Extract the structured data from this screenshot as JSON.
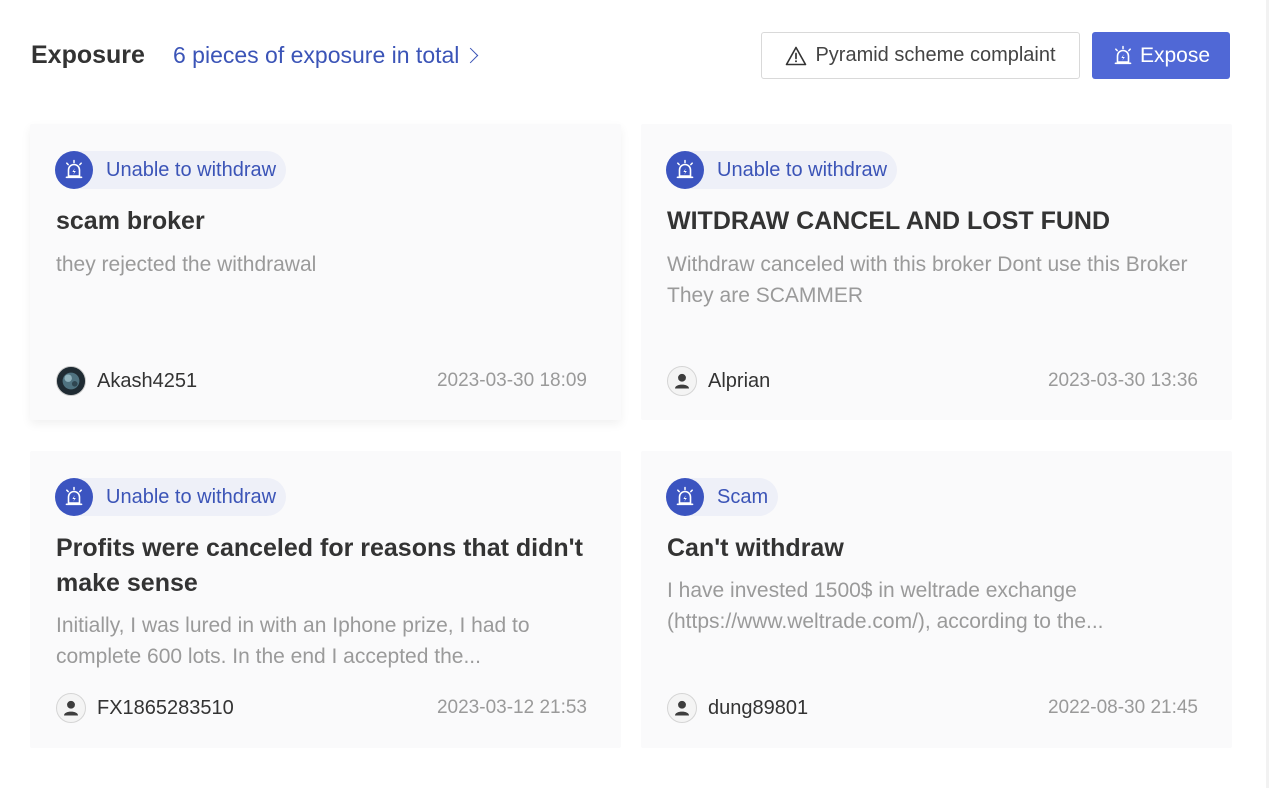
{
  "header": {
    "title": "Exposure",
    "count_link": "6 pieces of exposure in total",
    "complaint_button": "Pyramid scheme complaint",
    "expose_button": "Expose"
  },
  "cards": [
    {
      "tag": "Unable to withdraw",
      "title": "scam broker",
      "description": "they rejected the withdrawal",
      "author": "Akash4251",
      "avatar": "photo-avatar",
      "date": "2023-03-30 18:09"
    },
    {
      "tag": "Unable to withdraw",
      "title": "WITDRAW CANCEL AND LOST FUND",
      "description": "Withdraw canceled with this broker Dont use this Broker They are SCAMMER",
      "author": "Alprian",
      "avatar": "default-user-avatar",
      "date": "2023-03-30 13:36"
    },
    {
      "tag": "Unable to withdraw",
      "title": "Profits were canceled for reasons that didn't make sense",
      "description": "Initially, I was lured in with an Iphone prize, I had to complete 600 lots. In the end I accepted the...",
      "author": "FX1865283510",
      "avatar": "default-user-avatar",
      "date": "2023-03-12 21:53"
    },
    {
      "tag": "Scam",
      "title": "Can't withdraw",
      "description": "I have invested 1500$ in weltrade exchange (https://www.weltrade.com/), according to the...",
      "author": "dung89801",
      "avatar": "default-user-avatar",
      "date": "2022-08-30 21:45"
    }
  ],
  "icons": {
    "tag_icon": "alarm-siren-icon",
    "complaint_icon": "warning-triangle-icon",
    "expose_icon": "alarm-siren-icon"
  },
  "colors": {
    "accent": "#3b54b7",
    "button_primary": "#5068d6",
    "tag_background": "#eef0f8",
    "card_background": "#fafafb"
  }
}
